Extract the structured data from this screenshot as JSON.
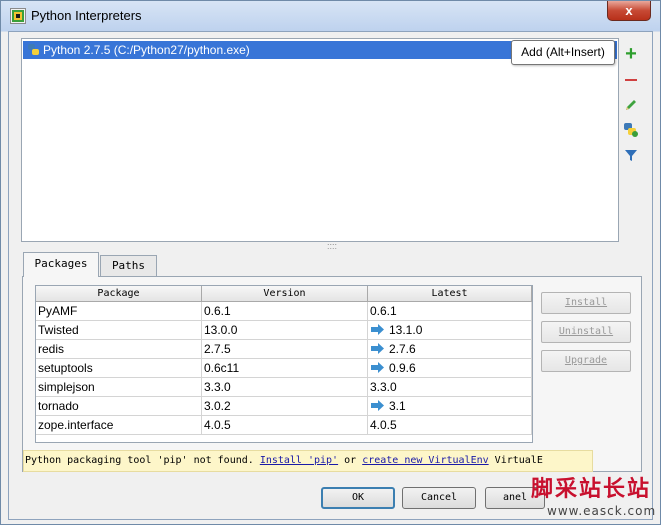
{
  "window": {
    "title": "Python Interpreters",
    "close_glyph": "x"
  },
  "interpreters": {
    "items": [
      {
        "label": "Python 2.7.5 (C:/Python27/python.exe)",
        "icon": "python-icon"
      }
    ]
  },
  "tooltip": {
    "text": "Add (Alt+Insert)"
  },
  "tools": {
    "add": "+",
    "icons": [
      "add-icon",
      "remove-icon",
      "edit-icon",
      "virtualenv-icon",
      "filter-icon"
    ]
  },
  "tabs": [
    {
      "label": "Packages",
      "selected": true
    },
    {
      "label": "Paths",
      "selected": false
    }
  ],
  "packages": {
    "columns": [
      "Package",
      "Version",
      "Latest"
    ],
    "rows": [
      {
        "name": "PyAMF",
        "version": "0.6.1",
        "latest": "0.6.1",
        "upgrade": false
      },
      {
        "name": "Twisted",
        "version": "13.0.0",
        "latest": "13.1.0",
        "upgrade": true
      },
      {
        "name": "redis",
        "version": "2.7.5",
        "latest": "2.7.6",
        "upgrade": true
      },
      {
        "name": "setuptools",
        "version": "0.6c11",
        "latest": "0.9.6",
        "upgrade": true
      },
      {
        "name": "simplejson",
        "version": "3.3.0",
        "latest": "3.3.0",
        "upgrade": false
      },
      {
        "name": "tornado",
        "version": "3.0.2",
        "latest": "3.1",
        "upgrade": true
      },
      {
        "name": "zope.interface",
        "version": "4.0.5",
        "latest": "4.0.5",
        "upgrade": false
      }
    ],
    "upgrade_arrow_color": "#3b8fd0"
  },
  "side_buttons": {
    "install": "Install",
    "uninstall": "Uninstall",
    "upgrade": "Upgrade"
  },
  "warning": {
    "prefix": "Python packaging tool 'pip' not found.",
    "link1": "Install 'pip'",
    "middle": "or",
    "link2": "create new VirtualEnv",
    "tail": "VirtualE"
  },
  "dialog_buttons": {
    "ok": "OK",
    "cancel": "Cancel",
    "cancel_partial": "anel"
  },
  "watermark": {
    "logo": "脚采站长站",
    "url": "www.easck.com"
  },
  "colors": {
    "selection": "#3875d7",
    "warning_bg": "#fdf6c9",
    "link": "#1a1aa8",
    "add_green": "#2e9e2e",
    "remove_red": "#d04040"
  }
}
